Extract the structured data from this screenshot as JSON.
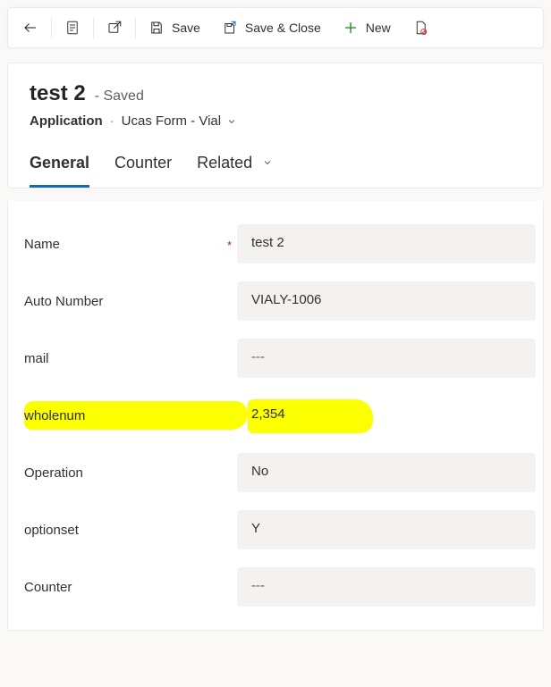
{
  "toolbar": {
    "save_label": "Save",
    "save_close_label": "Save & Close",
    "new_label": "New"
  },
  "header": {
    "title": "test 2",
    "status": "Saved",
    "entity": "Application",
    "form_name": "Ucas Form - Vial"
  },
  "tabs": {
    "general": "General",
    "counter": "Counter",
    "related": "Related"
  },
  "fields": {
    "name": {
      "label": "Name",
      "value": "test 2",
      "required": true
    },
    "autonumber": {
      "label": "Auto Number",
      "value": "VIALY-1006"
    },
    "mail": {
      "label": "mail",
      "value": "---"
    },
    "wholenum": {
      "label": "wholenum",
      "value": "2,354"
    },
    "operation": {
      "label": "Operation",
      "value": "No"
    },
    "optionset": {
      "label": "optionset",
      "value": "Y"
    },
    "counter": {
      "label": "Counter",
      "value": "---"
    }
  }
}
